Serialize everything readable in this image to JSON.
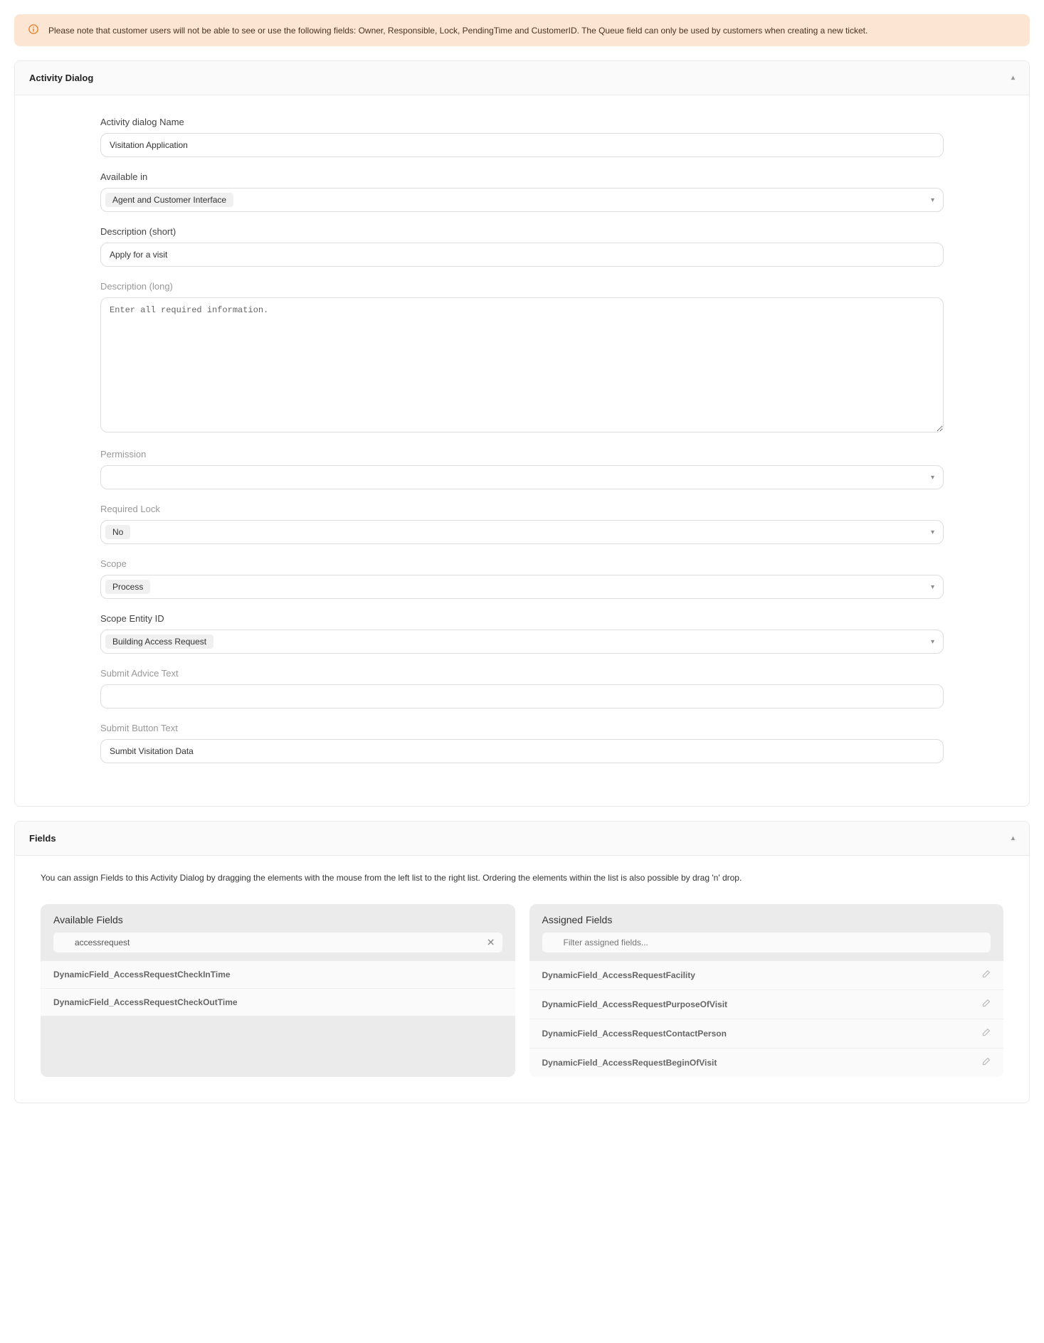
{
  "notice": {
    "text": "Please note that customer users will not be able to see or use the following fields: Owner, Responsible, Lock, PendingTime and CustomerID. The Queue field can only be used by customers when creating a new ticket."
  },
  "panels": {
    "activity": {
      "title": "Activity Dialog",
      "fields": {
        "name_label": "Activity dialog Name",
        "name_value": "Visitation Application",
        "available_label": "Available in",
        "available_value": "Agent and Customer Interface",
        "desc_short_label": "Description (short)",
        "desc_short_value": "Apply for a visit",
        "desc_long_label": "Description (long)",
        "desc_long_value": "Enter all required information.",
        "permission_label": "Permission",
        "permission_value": "",
        "reqlock_label": "Required Lock",
        "reqlock_value": "No",
        "scope_label": "Scope",
        "scope_value": "Process",
        "scope_entity_label": "Scope Entity ID",
        "scope_entity_value": "Building Access Request",
        "submit_advice_label": "Submit Advice Text",
        "submit_advice_value": "",
        "submit_button_label": "Submit Button Text",
        "submit_button_value": "Sumbit Visitation Data"
      }
    },
    "fields": {
      "title": "Fields",
      "help": "You can assign Fields to this Activity Dialog by dragging the elements with the mouse from the left list to the right list. Ordering the elements within the list is also possible by drag 'n' drop.",
      "available": {
        "title": "Available Fields",
        "filter_value": "accessrequest",
        "items": [
          "DynamicField_AccessRequestCheckInTime",
          "DynamicField_AccessRequestCheckOutTime"
        ]
      },
      "assigned": {
        "title": "Assigned Fields",
        "filter_placeholder": "Filter assigned fields...",
        "items": [
          "DynamicField_AccessRequestFacility",
          "DynamicField_AccessRequestPurposeOfVisit",
          "DynamicField_AccessRequestContactPerson",
          "DynamicField_AccessRequestBeginOfVisit"
        ]
      }
    }
  }
}
